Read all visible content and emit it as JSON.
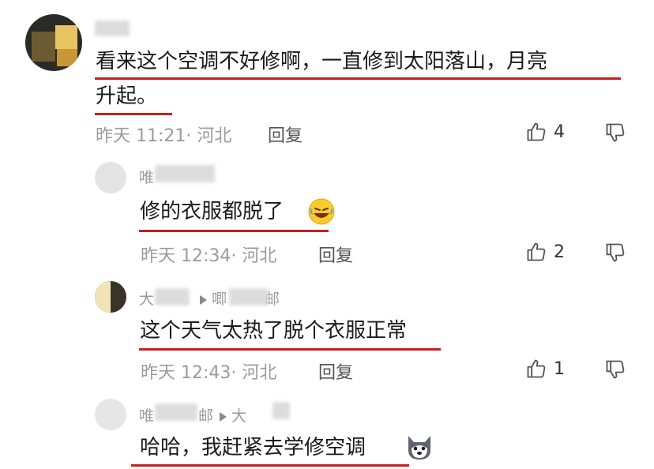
{
  "comments": [
    {
      "text": "看来这个空调不好修啊，一直修到太阳落山，月亮升起。",
      "line1": "看来这个空调不好修啊，一直修到太阳落山，月亮",
      "line2": "升起。",
      "meta": "昨天 11:21· 河北",
      "reply": "回复",
      "likes": "4"
    },
    {
      "name": "唯",
      "text": "修的衣服都脱了",
      "emoji": "rofl-emoji",
      "meta": "昨天 12:34· 河北",
      "reply": "回复",
      "likes": "2"
    },
    {
      "name": "大",
      "reply_to": "唧",
      "reply_to_tail": "邮",
      "text": "这个天气太热了脱个衣服正常",
      "meta": "昨天 12:43· 河北",
      "reply": "回复",
      "likes": "1"
    },
    {
      "name": "唯",
      "name_tail": "邮",
      "reply_to": "大",
      "text": "哈哈，我赶紧去学修空调",
      "emoji": "husky-emoji"
    }
  ],
  "colors": {
    "underline": "#c81e1e",
    "meta": "#9b9b9b"
  }
}
